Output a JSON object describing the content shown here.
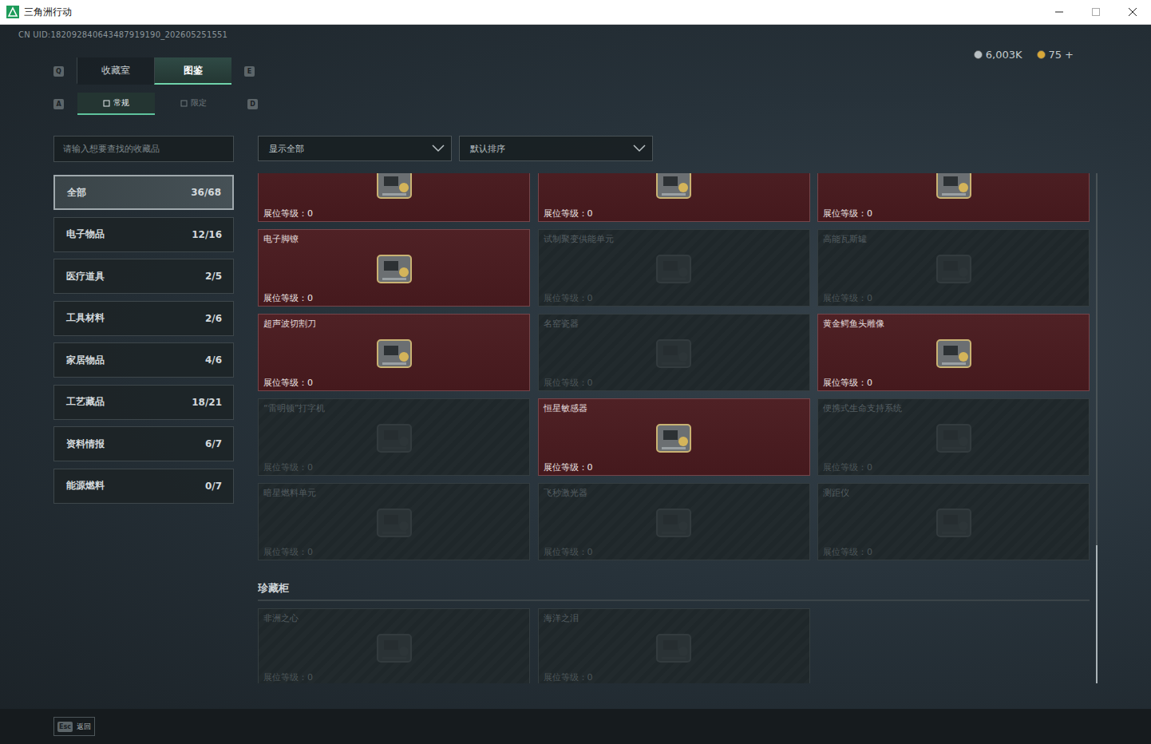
{
  "window": {
    "title": "三角洲行动"
  },
  "uid": "CN UID:182092840643487919190_202605251551",
  "currency": [
    {
      "amount": "6,003K",
      "color": "#b9c0c4"
    },
    {
      "amount": "75",
      "color": "#d8a838"
    }
  ],
  "currency_add": "+",
  "main_tabs": {
    "prev_key": "Q",
    "next_key": "E",
    "items": [
      {
        "label": "收藏室",
        "selected": false
      },
      {
        "label": "图鉴",
        "selected": true
      }
    ]
  },
  "sub_tabs": {
    "prev_key": "A",
    "next_key": "D",
    "items": [
      {
        "label": "常规",
        "selected": true
      },
      {
        "label": "限定",
        "selected": false
      }
    ]
  },
  "search": {
    "placeholder": "请输入想要查找的收藏品"
  },
  "filters": [
    {
      "value": "显示全部"
    },
    {
      "value": "默认排序"
    }
  ],
  "categories": [
    {
      "label": "全部",
      "count": "36/68",
      "selected": true
    },
    {
      "label": "电子物品",
      "count": "12/16",
      "selected": false
    },
    {
      "label": "医疗道具",
      "count": "2/5",
      "selected": false
    },
    {
      "label": "工具材料",
      "count": "2/6",
      "selected": false
    },
    {
      "label": "家居物品",
      "count": "4/6",
      "selected": false
    },
    {
      "label": "工艺藏品",
      "count": "18/21",
      "selected": false
    },
    {
      "label": "资料情报",
      "count": "6/7",
      "selected": false
    },
    {
      "label": "能源燃料",
      "count": "0/7",
      "selected": false
    }
  ],
  "collection": {
    "level_label": "展位等级：",
    "items": [
      {
        "name": "",
        "owned": true,
        "level": "0"
      },
      {
        "name": "",
        "owned": true,
        "level": "0"
      },
      {
        "name": "",
        "owned": true,
        "level": "0"
      },
      {
        "name": "电子脚镣",
        "owned": true,
        "level": "0"
      },
      {
        "name": "试制聚变供能单元",
        "owned": false,
        "level": "0"
      },
      {
        "name": "高能瓦斯罐",
        "owned": false,
        "level": "0"
      },
      {
        "name": "超声波切割刀",
        "owned": true,
        "level": "0"
      },
      {
        "name": "名窑瓷器",
        "owned": false,
        "level": "0"
      },
      {
        "name": "黄金鳄鱼头雕像",
        "owned": true,
        "level": "0"
      },
      {
        "name": "“雷明顿”打字机",
        "owned": false,
        "level": "0"
      },
      {
        "name": "恒星敏感器",
        "owned": true,
        "level": "0"
      },
      {
        "name": "便携式生命支持系统",
        "owned": false,
        "level": "0"
      },
      {
        "name": "暗星燃料单元",
        "owned": false,
        "level": "0"
      },
      {
        "name": "飞秒激光器",
        "owned": false,
        "level": "0"
      },
      {
        "name": "测距仪",
        "owned": false,
        "level": "0"
      }
    ]
  },
  "cabinet": {
    "title": "珍藏柜",
    "items": [
      {
        "name": "非洲之心",
        "owned": false,
        "level": "0"
      },
      {
        "name": "海洋之泪",
        "owned": false,
        "level": "0"
      }
    ]
  },
  "scrollbar": {
    "level": 0.27
  },
  "footer": {
    "key": "Esc",
    "label": "返回"
  }
}
